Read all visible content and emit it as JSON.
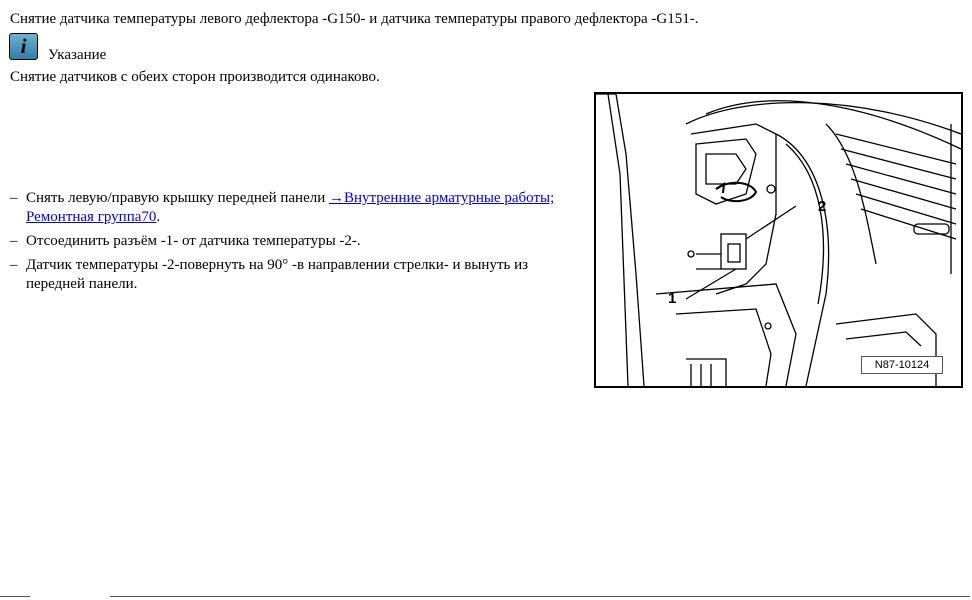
{
  "title": "Снятие датчика температуры левого дефлектора -G150- и датчика температуры правого дефлектора -G151-.",
  "note": {
    "icon": "info-icon",
    "icon_glyph": "i",
    "label": "Указание",
    "text": "Снятие датчиков с обеих сторон производится одинаково."
  },
  "steps": [
    {
      "text": "Снять левую/правую крышку передней панели ",
      "link": "→Внутренние арматурные работы; Ремонтная группа70",
      "suffix": "."
    },
    {
      "text": "Отсоединить разъём -1- от датчика температуры -2-."
    },
    {
      "text": "Датчик температуры -2-повернуть на 90° -в направлении стрелки- и вынуть из передней панели."
    }
  ],
  "figure": {
    "callout_1": "1",
    "callout_2": "2",
    "figure_number": "N87-10124"
  },
  "colors": {
    "link": "#0000ee",
    "info_icon": "#3f8fb8"
  }
}
